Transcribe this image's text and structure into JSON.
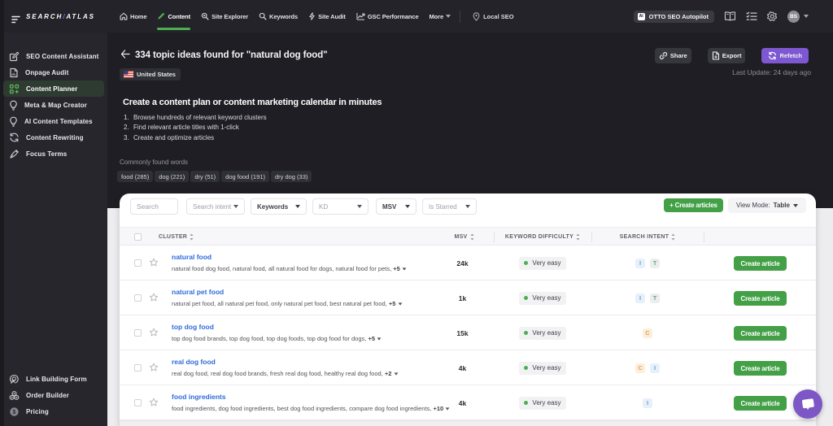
{
  "colors": {
    "accent_green": "#4CAF50",
    "accent_purple": "#7E57D2",
    "link_blue": "#2E6BDB",
    "dark_bg": "#1E1E24",
    "sidebar_bg": "#26262C",
    "card_bg": "#FFFFFF",
    "page_light_bg": "#EDEDF0"
  },
  "topbar": {
    "logo_left": "SEARCH",
    "logo_slash": "/",
    "logo_right": "ATLAS",
    "nav": [
      {
        "label": "Home"
      },
      {
        "label": "Content"
      },
      {
        "label": "Site Explorer"
      },
      {
        "label": "Keywords"
      },
      {
        "label": "Site Audit"
      },
      {
        "label": "GSC Performance"
      },
      {
        "label": "More"
      }
    ],
    "local_seo": "Local SEO",
    "otto_label": "OTTO SEO Autopilot",
    "otto_icon_text": "AI",
    "avatar_initials": "BS"
  },
  "sidebar": {
    "items": [
      {
        "label": "SEO Content Assistant"
      },
      {
        "label": "Onpage Audit"
      },
      {
        "label": "Content Planner"
      },
      {
        "label": "Meta & Map Creator"
      },
      {
        "label": "AI Content Templates"
      },
      {
        "label": "Content Rewriting"
      },
      {
        "label": "Focus Terms"
      }
    ],
    "bottom_items": [
      {
        "label": "Link Building Form"
      },
      {
        "label": "Order Builder"
      },
      {
        "label": "Pricing"
      }
    ]
  },
  "header": {
    "title": "334 topic ideas found for \"natural dog food\"",
    "country": "United States",
    "share_label": "Share",
    "export_label": "Export",
    "refetch_label": "Refetch",
    "last_update": "Last Update: 24 days ago"
  },
  "intro": {
    "heading": "Create a content plan or content marketing calendar in minutes",
    "step_numbers": [
      "1.",
      "2.",
      "3."
    ],
    "steps": [
      "Browse hundreds of relevant keyword clusters",
      "Find relevant article titles with 1-click",
      "Create and optimize articles"
    ],
    "common_words_label": "Commonly found words",
    "words": [
      "food (285)",
      "dog (221)",
      "dry (51)",
      "dog food (191)",
      "dry dog (33)"
    ]
  },
  "filters": {
    "search_placeholder": "Search",
    "search_intent": "Search intent",
    "keywords": "Keywords",
    "kd": "KD",
    "msv": "MSV",
    "is_starred": "Is Starred",
    "create_articles": "+ Create articles",
    "view_mode_label": "View Mode:",
    "view_mode_value": "Table"
  },
  "table": {
    "headers": {
      "cluster": "CLUSTER",
      "msv": "MSV",
      "difficulty": "KEYWORD DIFFICULTY",
      "intent": "SEARCH INTENT"
    },
    "row_button": "Create article",
    "rows": [
      {
        "name": "natural food",
        "keywords": "natural food dog food, natural food, all natural food for dogs, natural food for pets,",
        "more": "+5",
        "msv": "24k",
        "difficulty": "Very easy",
        "intents": [
          "I",
          "T"
        ]
      },
      {
        "name": "natural pet food",
        "keywords": "natural pet food, all natural pet food, only natural pet food, best natural pet food,",
        "more": "+5",
        "msv": "1k",
        "difficulty": "Very easy",
        "intents": [
          "I",
          "T"
        ]
      },
      {
        "name": "top dog food",
        "keywords": "top dog food brands, top dog food, top dog foods, top dog food for dogs,",
        "more": "+5",
        "msv": "15k",
        "difficulty": "Very easy",
        "intents": [
          "C"
        ]
      },
      {
        "name": "real dog food",
        "keywords": "real dog food, real dog food brands, fresh real dog food, healthy real dog food,",
        "more": "+2",
        "msv": "4k",
        "difficulty": "Very easy",
        "intents": [
          "C",
          "I"
        ]
      },
      {
        "name": "food ingredients",
        "keywords": "food ingredients, dog food ingredients, best dog food ingredients, compare dog food ingredients,",
        "more": "+10",
        "msv": "4k",
        "difficulty": "Very easy",
        "intents": [
          "I"
        ]
      }
    ]
  }
}
